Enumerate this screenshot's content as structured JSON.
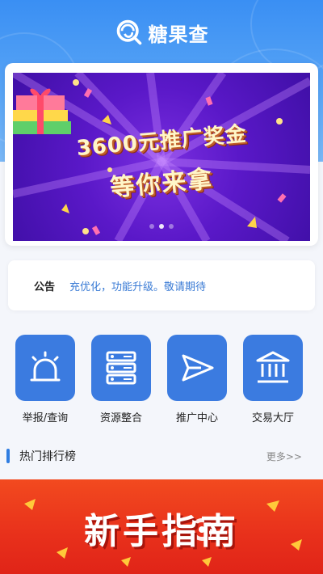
{
  "app": {
    "logo_text": "糖果查"
  },
  "banner": {
    "line1": "3600元推广奖金",
    "line2": "等你来拿"
  },
  "notice": {
    "label": "公告",
    "text": "充优化，功能升级。敬请期待"
  },
  "features": [
    {
      "label": "举报/查询",
      "icon": "alarm-icon"
    },
    {
      "label": "资源整合",
      "icon": "server-icon"
    },
    {
      "label": "推广中心",
      "icon": "send-icon"
    },
    {
      "label": "交易大厅",
      "icon": "bank-icon"
    }
  ],
  "ranking": {
    "title": "热门排行榜",
    "more": "更多>>"
  },
  "promo": {
    "text": "新手指南"
  },
  "colors": {
    "header": "#3a8ff3",
    "tile": "#3b7be0",
    "accent": "#2f7de1",
    "promo": "#e8301b"
  }
}
